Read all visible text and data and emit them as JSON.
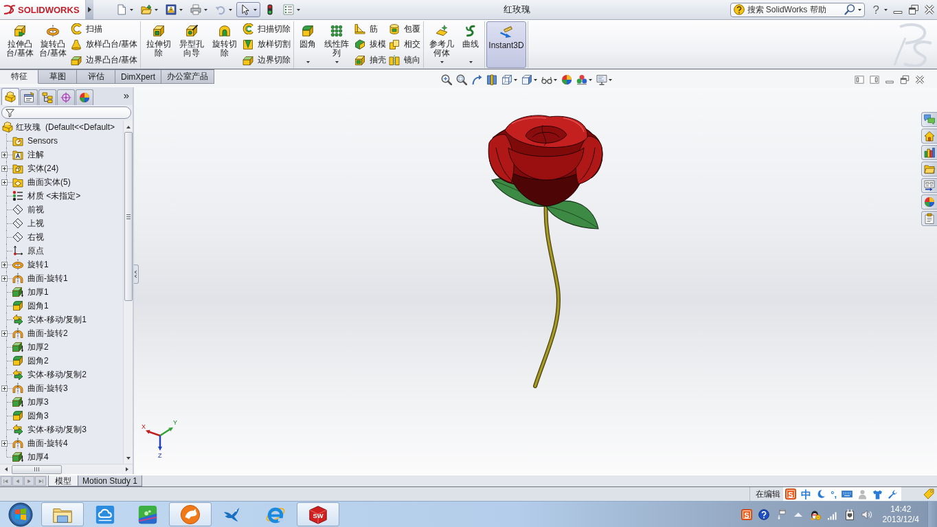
{
  "app_menu": {
    "logo_text": "SOLIDWORKS"
  },
  "quick_access": [
    {
      "kind": "new",
      "dropdown": true,
      "selected": false,
      "disabled": false
    },
    {
      "kind": "open",
      "dropdown": true,
      "selected": false,
      "disabled": false
    },
    {
      "kind": "save",
      "dropdown": true,
      "selected": false,
      "disabled": false
    },
    {
      "kind": "print",
      "dropdown": true,
      "selected": false,
      "disabled": false
    },
    {
      "kind": "undo",
      "dropdown": true,
      "selected": false,
      "disabled": true
    },
    {
      "kind": "select",
      "dropdown": true,
      "selected": true,
      "disabled": false
    },
    {
      "kind": "rebuild",
      "dropdown": false,
      "selected": false,
      "disabled": false
    },
    {
      "kind": "options",
      "dropdown": true,
      "selected": false,
      "disabled": false
    }
  ],
  "window": {
    "title": "红玫瑰"
  },
  "search": {
    "placeholder": "搜索 SolidWorks 帮助"
  },
  "help_button": {
    "glyph": "?"
  },
  "ribbon": {
    "groups": [
      {
        "large": [
          {
            "kind": "extrude",
            "label": "拉伸凸台/基体",
            "dropdown": false,
            "selected": false
          },
          {
            "kind": "revolve",
            "label": "旋转凸台/基体",
            "dropdown": false,
            "selected": false
          }
        ],
        "columns": [
          [
            {
              "kind": "sweep",
              "label": "扫描"
            },
            {
              "kind": "loft",
              "label": "放样凸台/基体"
            },
            {
              "kind": "boundary",
              "label": "边界凸台/基体"
            }
          ]
        ]
      },
      {
        "large": [
          {
            "kind": "cutextrude",
            "label": "拉伸切除",
            "dropdown": false,
            "selected": false
          },
          {
            "kind": "hole",
            "label": "异型孔向导",
            "dropdown": false,
            "selected": false
          },
          {
            "kind": "cutrevolve",
            "label": "旋转切除",
            "dropdown": false,
            "selected": false
          }
        ],
        "columns": [
          [
            {
              "kind": "cutsweep",
              "label": "扫描切除"
            },
            {
              "kind": "cutloft",
              "label": "放样切割"
            },
            {
              "kind": "cutboundary",
              "label": "边界切除"
            }
          ]
        ]
      },
      {
        "large": [
          {
            "kind": "fillet",
            "label": "圆角",
            "dropdown": true,
            "selected": false
          },
          {
            "kind": "pattern",
            "label": "线性阵列",
            "dropdown": true,
            "selected": false
          }
        ],
        "columns": [
          [
            {
              "kind": "rib",
              "label": "筋"
            },
            {
              "kind": "draft",
              "label": "拔模"
            },
            {
              "kind": "shell",
              "label": "抽壳"
            }
          ],
          [
            {
              "kind": "wrap",
              "label": "包覆"
            },
            {
              "kind": "intersect",
              "label": "相交"
            },
            {
              "kind": "mirror",
              "label": "镜向"
            }
          ]
        ]
      },
      {
        "large": [
          {
            "kind": "refgeom",
            "label": "参考几何体",
            "dropdown": true,
            "selected": false
          },
          {
            "kind": "curve",
            "label": "曲线",
            "dropdown": true,
            "selected": false
          }
        ]
      },
      {
        "large": [
          {
            "kind": "instant3d",
            "label": "Instant3D",
            "dropdown": false,
            "selected": true
          }
        ]
      }
    ]
  },
  "tabs": [
    {
      "label": "特征",
      "selected": true
    },
    {
      "label": "草图",
      "selected": false
    },
    {
      "label": "评估",
      "selected": false
    },
    {
      "label": "DimXpert",
      "selected": false
    },
    {
      "label": "办公室产品",
      "selected": false
    }
  ],
  "view_toolbar": [
    {
      "kind": "zoomfit",
      "dropdown": false
    },
    {
      "kind": "zoomarea",
      "dropdown": false
    },
    {
      "kind": "prevview",
      "dropdown": false
    },
    {
      "kind": "section",
      "dropdown": false
    },
    {
      "kind": "orientation",
      "dropdown": true
    },
    {
      "kind": "displaystyle",
      "dropdown": true
    },
    {
      "kind": "hideshow",
      "dropdown": true
    },
    {
      "kind": "appearance",
      "dropdown": false
    },
    {
      "kind": "scene",
      "dropdown": true
    },
    {
      "kind": "viewsettings",
      "dropdown": true
    }
  ],
  "panel_tabs": [
    {
      "kind": "feature",
      "selected": true
    },
    {
      "kind": "property",
      "selected": false
    },
    {
      "kind": "config",
      "selected": false
    },
    {
      "kind": "dimxpert",
      "selected": false
    },
    {
      "kind": "display",
      "selected": false
    }
  ],
  "panel_more": "»",
  "tree": {
    "name": "红玫瑰",
    "config": "(Default<<Default>",
    "children": [
      {
        "kind": "sensor",
        "label": "Sensors"
      },
      {
        "kind": "annotation",
        "label": "注解",
        "expanded": false
      },
      {
        "kind": "bodies",
        "label": "实体(24)",
        "expanded": false
      },
      {
        "kind": "surfaces",
        "label": "曲面实体(5)",
        "expanded": false
      },
      {
        "kind": "material",
        "label": "材质 <未指定>"
      },
      {
        "kind": "plane",
        "label": "前视"
      },
      {
        "kind": "plane",
        "label": "上视"
      },
      {
        "kind": "plane",
        "label": "右视"
      },
      {
        "kind": "origin",
        "label": "原点"
      },
      {
        "kind": "revolve",
        "label": "旋转1",
        "expanded": false
      },
      {
        "kind": "surfrevolve",
        "label": "曲面-旋转1",
        "expanded": false
      },
      {
        "kind": "thicken",
        "label": "加厚1"
      },
      {
        "kind": "fillet",
        "label": "圆角1"
      },
      {
        "kind": "movecopy",
        "label": "实体-移动/复制1"
      },
      {
        "kind": "surfrevolve",
        "label": "曲面-旋转2",
        "expanded": false
      },
      {
        "kind": "thicken",
        "label": "加厚2"
      },
      {
        "kind": "fillet",
        "label": "圆角2"
      },
      {
        "kind": "movecopy",
        "label": "实体-移动/复制2"
      },
      {
        "kind": "surfrevolve",
        "label": "曲面-旋转3",
        "expanded": false
      },
      {
        "kind": "thicken",
        "label": "加厚3"
      },
      {
        "kind": "fillet",
        "label": "圆角3"
      },
      {
        "kind": "movecopy",
        "label": "实体-移动/复制3"
      },
      {
        "kind": "surfrevolve",
        "label": "曲面-旋转4",
        "expanded": false
      },
      {
        "kind": "thicken",
        "label": "加厚4"
      }
    ]
  },
  "triad": {
    "x": "X",
    "y": "Y",
    "z": "Z"
  },
  "model_tabs": [
    {
      "label": "模型",
      "selected": true
    },
    {
      "label": "Motion Study 1",
      "selected": false
    }
  ],
  "status": {
    "text": "在编辑"
  },
  "ime": {
    "logo": "S",
    "mode": "中",
    "punct": "°,"
  },
  "taskbar": {
    "apps": [
      {
        "kind": "explorer",
        "open": true
      },
      {
        "kind": "cloud",
        "open": false
      },
      {
        "kind": "greenapp",
        "open": false
      },
      {
        "kind": "cheetah",
        "open": true
      },
      {
        "kind": "bird",
        "open": false
      },
      {
        "kind": "ie",
        "open": false
      },
      {
        "kind": "solidworks",
        "open": true,
        "text": "SW"
      }
    ],
    "tray": [
      {
        "kind": "sogou",
        "text": "S"
      },
      {
        "kind": "help"
      },
      {
        "kind": "network"
      },
      {
        "kind": "more"
      },
      {
        "kind": "qq"
      },
      {
        "kind": "signal"
      },
      {
        "kind": "power"
      },
      {
        "kind": "volume"
      }
    ],
    "time": "14:42",
    "date": "2013/12/4"
  }
}
